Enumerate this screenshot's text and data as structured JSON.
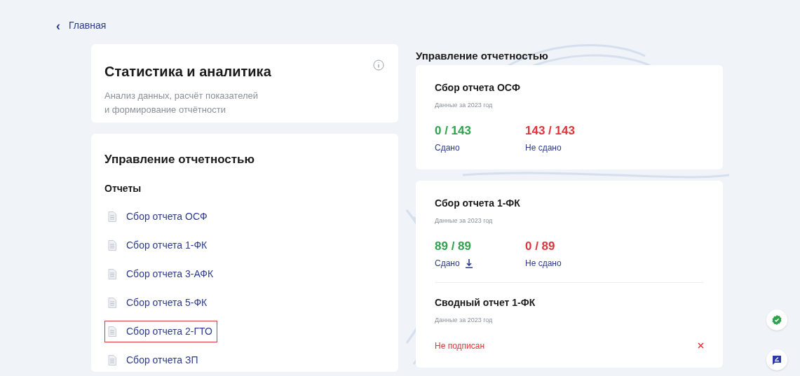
{
  "back_link": {
    "icon": "‹",
    "label": "Главная"
  },
  "intro": {
    "title": "Статистика и аналитика",
    "description": "Анализ данных, расчёт показателей\nи формирование отчётности"
  },
  "reports_panel": {
    "title": "Управление отчетностью",
    "subtitle": "Отчеты",
    "items": [
      {
        "label": "Сбор отчета ОСФ",
        "highlighted": false
      },
      {
        "label": "Сбор отчета 1-ФК",
        "highlighted": false
      },
      {
        "label": "Сбор отчета 3-АФК",
        "highlighted": false
      },
      {
        "label": "Сбор отчета 5-ФК",
        "highlighted": false
      },
      {
        "label": "Сбор отчета 2-ГТО",
        "highlighted": true
      },
      {
        "label": "Сбор отчета ЗП",
        "highlighted": false
      }
    ]
  },
  "management": {
    "title": "Управление отчетностью",
    "cards": [
      {
        "sections": [
          {
            "kind": "stats",
            "title": "Сбор отчета ОСФ",
            "subtitle": "Данные за 2023 год",
            "stats": [
              {
                "value": "0 / 143",
                "label": "Сдано",
                "color": "#2fa24d",
                "download": false
              },
              {
                "value": "143 / 143",
                "label": "Не сдано",
                "color": "#e0343a",
                "download": false
              }
            ]
          }
        ]
      },
      {
        "sections": [
          {
            "kind": "stats",
            "title": "Сбор отчета 1-ФК",
            "subtitle": "Данные за 2023 год",
            "stats": [
              {
                "value": "89 / 89",
                "label": "Сдано",
                "color": "#2fa24d",
                "download": true
              },
              {
                "value": "0 / 89",
                "label": "Не сдано",
                "color": "#e0343a",
                "download": false
              }
            ]
          },
          {
            "kind": "signature",
            "title": "Сводный отчет 1-ФК",
            "subtitle": "Данные за 2023 год",
            "status": "Не подписан"
          }
        ]
      }
    ]
  }
}
